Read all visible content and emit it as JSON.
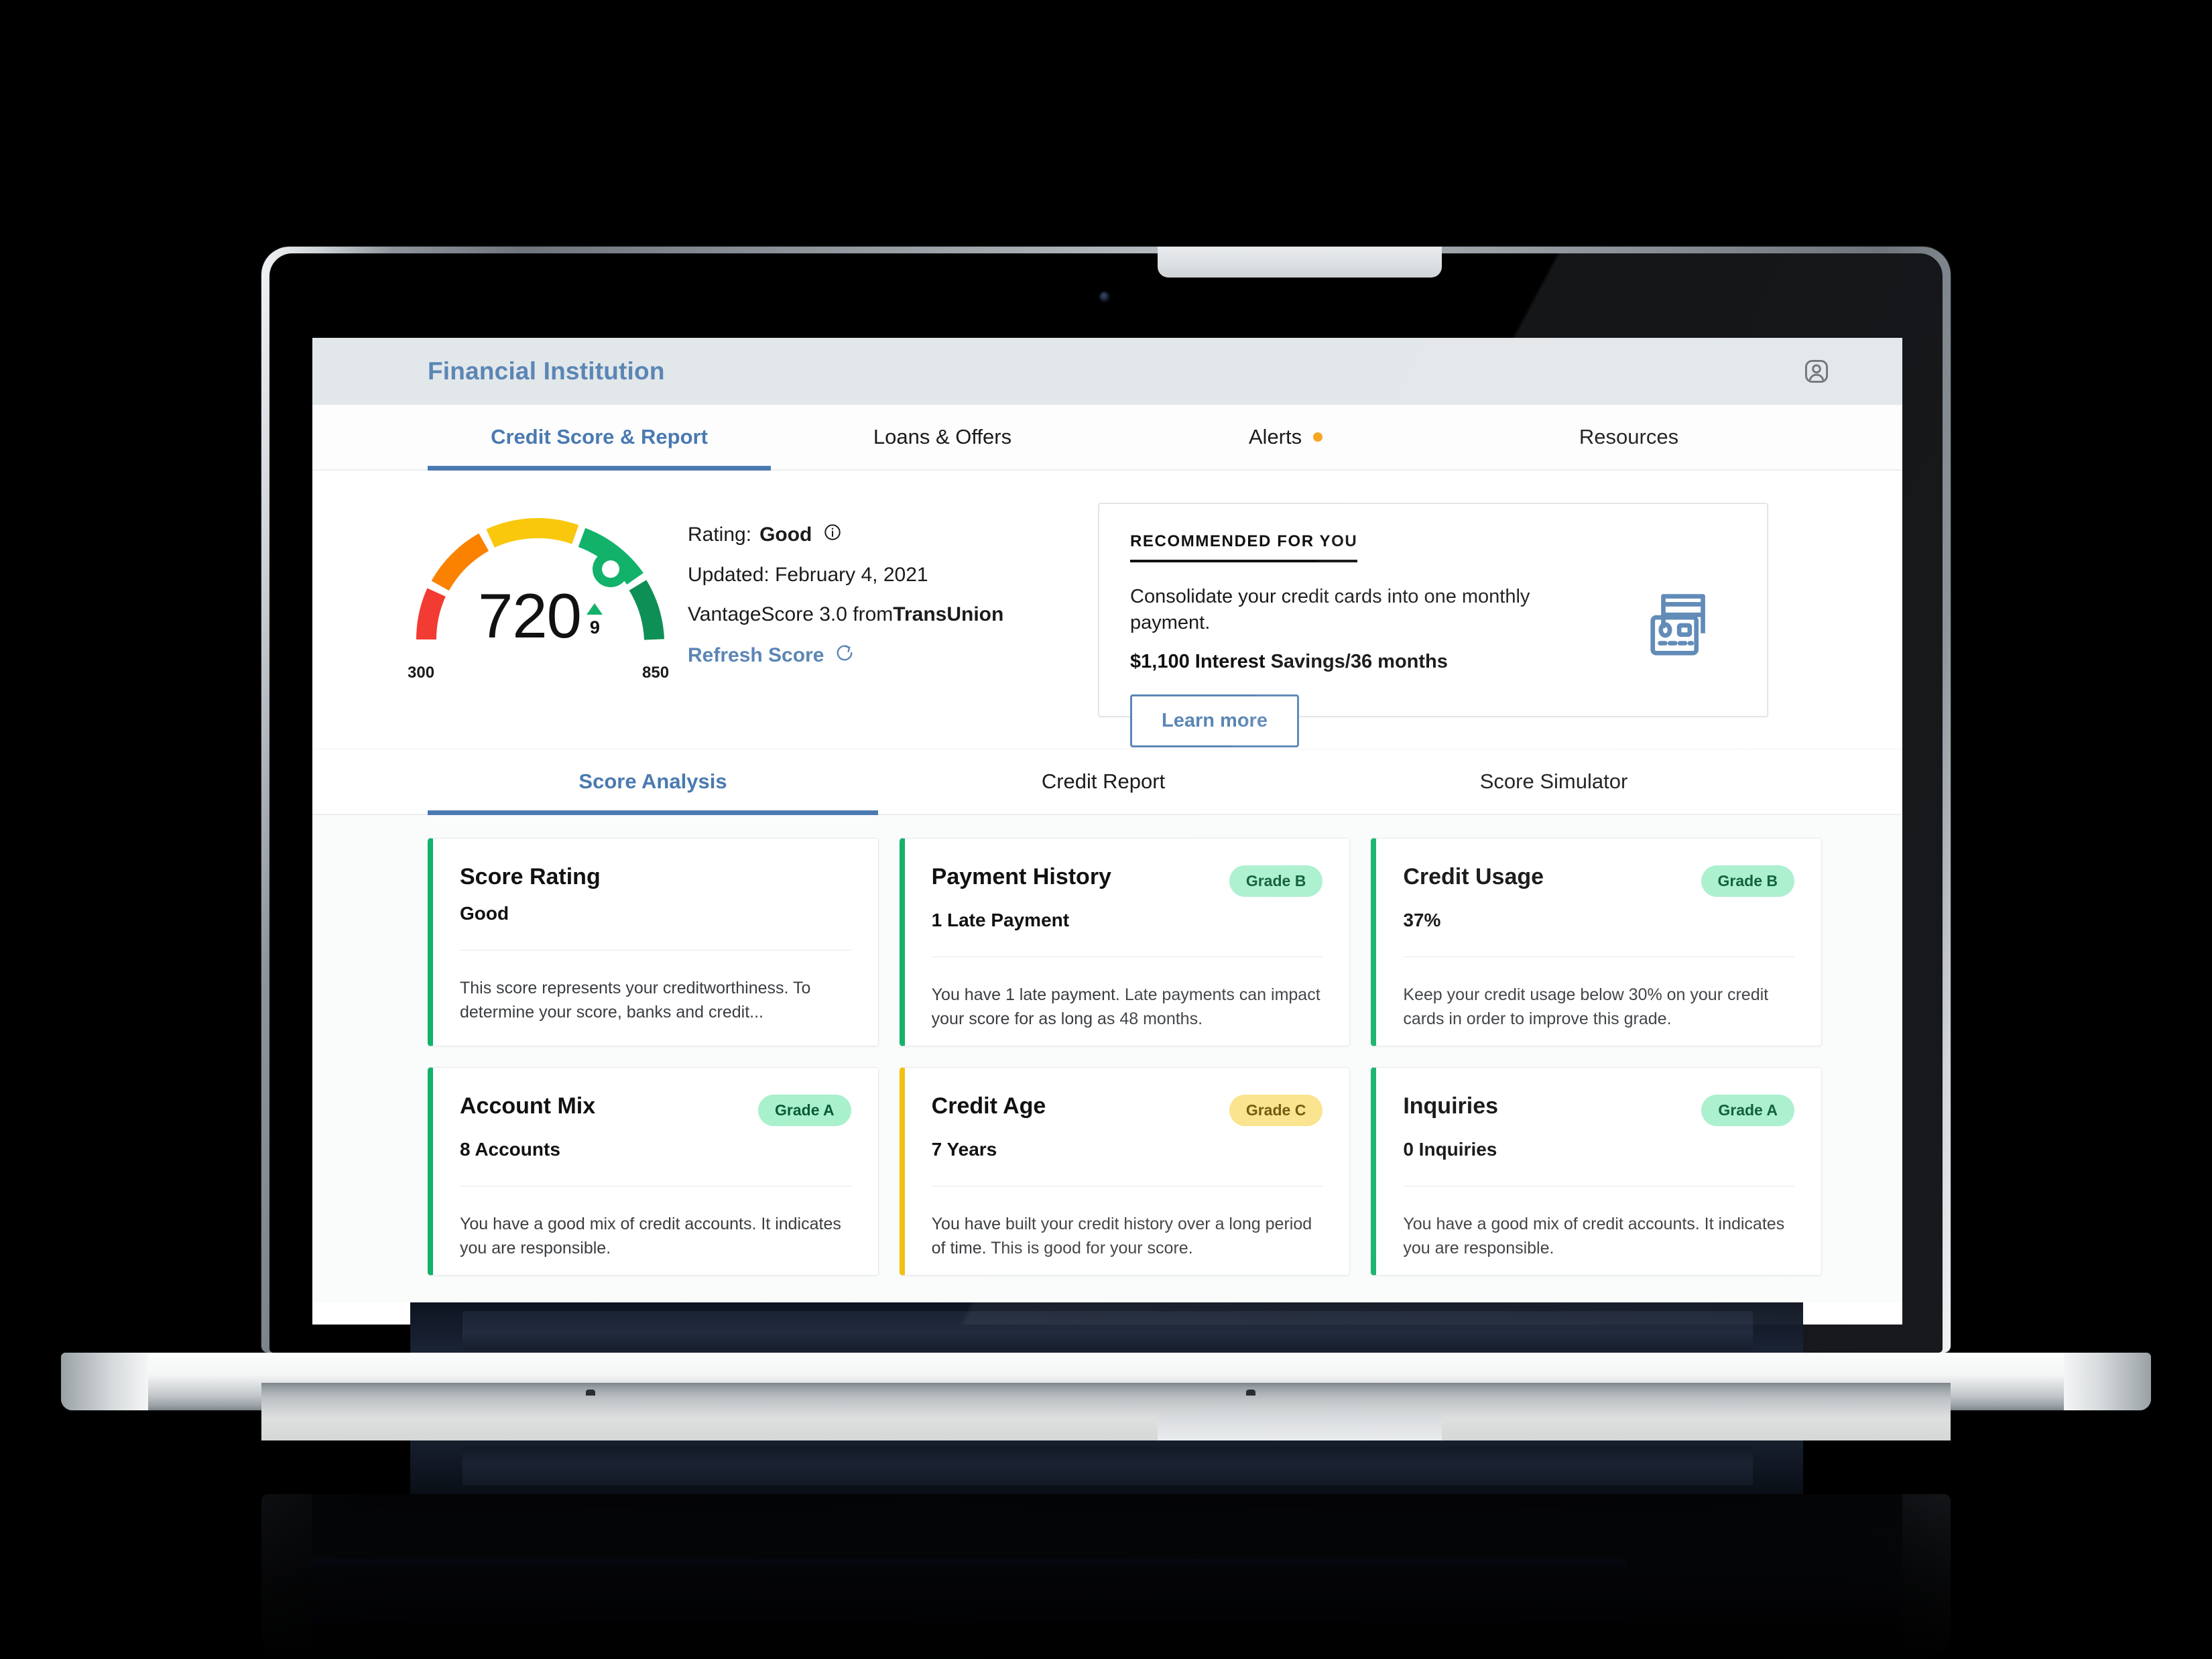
{
  "app": {
    "brand": "Financial Institution",
    "account_icon": "account-person-icon"
  },
  "primary_nav": {
    "tabs": [
      {
        "label": "Credit Score & Report",
        "active": true,
        "badge": false
      },
      {
        "label": "Loans & Offers",
        "active": false,
        "badge": false
      },
      {
        "label": "Alerts",
        "active": false,
        "badge": true
      },
      {
        "label": "Resources",
        "active": false,
        "badge": false
      }
    ],
    "badge_color": "#f5a623",
    "active_color": "#4a7ab0"
  },
  "score": {
    "value": "720",
    "delta": "9",
    "delta_direction": "up",
    "range_min": "300",
    "range_max": "850",
    "rating_label": "Rating:",
    "rating_value": "Good",
    "updated": "Updated: February 4, 2021",
    "source_prefix": "VantageScore 3.0 from ",
    "source_bureau": "TransUnion",
    "refresh_label": "Refresh Score",
    "gauge_colors": {
      "red": "#f23b32",
      "orange": "#fa8200",
      "yellow": "#f9c80c",
      "green": "#13b26a",
      "dark_green": "#0e8f55"
    }
  },
  "recommendation": {
    "kicker": "RECOMMENDED FOR YOU",
    "text": "Consolidate your credit cards into one monthly payment.",
    "highlight": "$1,100 Interest Savings/36 months",
    "button": "Learn more",
    "icon": "credit-cards-icon",
    "accent": "#5b86b5"
  },
  "secondary_nav": {
    "tabs": [
      {
        "label": "Score Analysis",
        "active": true
      },
      {
        "label": "Credit Report",
        "active": false
      },
      {
        "label": "Score Simulator",
        "active": false
      }
    ]
  },
  "metrics": [
    {
      "title": "Score Rating",
      "grade": null,
      "value": "Good",
      "description": "This score represents your creditworthiness. To determine your score, banks and credit...",
      "accent": "green"
    },
    {
      "title": "Payment History",
      "grade": "Grade B",
      "grade_style": "green",
      "value": "1 Late Payment",
      "description": "You have 1 late payment. Late payments can impact your score for as long as 48 months.",
      "accent": "green"
    },
    {
      "title": "Credit Usage",
      "grade": "Grade B",
      "grade_style": "green",
      "value": "37%",
      "description": "Keep your credit usage below 30% on your credit cards in order to improve this grade.",
      "accent": "green"
    },
    {
      "title": "Account Mix",
      "grade": "Grade A",
      "grade_style": "green",
      "value": "8 Accounts",
      "description": "You have a good mix of credit accounts. It indicates you are responsible.",
      "accent": "green"
    },
    {
      "title": "Credit Age",
      "grade": "Grade C",
      "grade_style": "yellow",
      "value": "7 Years",
      "description": "You have built your credit history over a long period of time. This is good for your score.",
      "accent": "yellow"
    },
    {
      "title": "Inquiries",
      "grade": "Grade A",
      "grade_style": "green",
      "value": "0 Inquiries",
      "description": "You have a good mix of credit accounts. It indicates you are responsible.",
      "accent": "green"
    }
  ],
  "colors": {
    "grade_green_bg": "#a9f0cd",
    "grade_green_text": "#0a5b39",
    "grade_yellow_bg": "#fbe389",
    "grade_yellow_text": "#6b5404",
    "card_accent_green": "#13b26a",
    "card_accent_yellow": "#f2c10f",
    "header_bg": "#e2e7ea",
    "brand_blue": "#5b86b5"
  }
}
